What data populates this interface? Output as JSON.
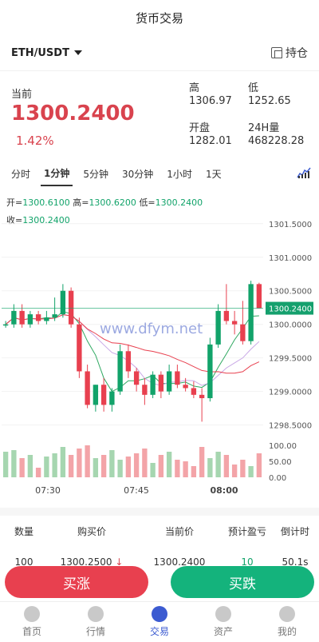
{
  "header": {
    "title": "货币交易"
  },
  "pairbar": {
    "pair": "ETH/USDT",
    "position_label": "持仓"
  },
  "stats": {
    "current_label": "当前",
    "current_price": "1300.2400",
    "change_pct": "1.42%",
    "high_label": "高",
    "high_value": "1306.97",
    "low_label": "低",
    "low_value": "1252.65",
    "open_label": "开盘",
    "open_value": "1282.01",
    "vol_label": "24H量",
    "vol_value": "468228.28"
  },
  "tabs": [
    "分时",
    "1分钟",
    "5分钟",
    "30分钟",
    "1小时",
    "1天"
  ],
  "active_tab": 1,
  "ohlc": {
    "open_label": "开=",
    "open": "1300.6100",
    "high_label": "高=",
    "high": "1300.6200",
    "low_label": "低=",
    "low": "1300.2400",
    "close_label": "收=",
    "close": "1300.2400"
  },
  "watermark": "www.dfym.net",
  "chart_data": {
    "type": "candlestick",
    "y_ticks": [
      "1301.5000",
      "1301.0000",
      "1300.5000",
      "1300.0000",
      "1299.5000",
      "1299.0000",
      "1298.5000"
    ],
    "ylim": [
      1298.4,
      1301.7
    ],
    "last_price": "1300.2400",
    "x_ticks": [
      "07:30",
      "07:45",
      "08:00"
    ],
    "vol_ticks": [
      "100.00",
      "50.00",
      "0.00"
    ],
    "candles": [
      [
        1300.0,
        1300.05,
        1299.95,
        1300.0
      ],
      [
        1300.0,
        1300.3,
        1299.95,
        1300.2
      ],
      [
        1300.2,
        1300.3,
        1299.95,
        1300.0
      ],
      [
        1300.0,
        1300.2,
        1299.95,
        1300.15
      ],
      [
        1300.15,
        1300.2,
        1300.0,
        1300.05
      ],
      [
        1300.05,
        1300.2,
        1300.0,
        1300.1
      ],
      [
        1300.1,
        1300.4,
        1300.05,
        1300.15
      ],
      [
        1300.15,
        1300.6,
        1300.1,
        1300.5
      ],
      [
        1300.5,
        1300.55,
        1299.95,
        1300.0
      ],
      [
        1300.0,
        1300.1,
        1299.2,
        1299.3
      ],
      [
        1299.3,
        1299.4,
        1298.75,
        1298.8
      ],
      [
        1298.8,
        1299.1,
        1298.7,
        1299.1
      ],
      [
        1299.1,
        1299.2,
        1298.7,
        1298.8
      ],
      [
        1298.8,
        1299.05,
        1298.7,
        1299.0
      ],
      [
        1299.0,
        1299.7,
        1298.95,
        1299.6
      ],
      [
        1299.6,
        1299.7,
        1299.2,
        1299.3
      ],
      [
        1299.3,
        1299.35,
        1299.0,
        1299.1
      ],
      [
        1299.1,
        1299.2,
        1298.8,
        1298.95
      ],
      [
        1298.95,
        1299.3,
        1298.9,
        1299.25
      ],
      [
        1299.25,
        1299.3,
        1298.9,
        1299.0
      ],
      [
        1299.0,
        1299.4,
        1298.95,
        1299.3
      ],
      [
        1299.3,
        1299.4,
        1299.05,
        1299.1
      ],
      [
        1299.1,
        1299.2,
        1299.0,
        1299.05
      ],
      [
        1299.05,
        1299.15,
        1298.9,
        1298.95
      ],
      [
        1298.95,
        1299.05,
        1298.55,
        1298.9
      ],
      [
        1298.9,
        1299.8,
        1298.85,
        1299.7
      ],
      [
        1299.7,
        1300.3,
        1299.65,
        1300.2
      ],
      [
        1300.2,
        1300.6,
        1300.0,
        1300.05
      ],
      [
        1300.05,
        1300.2,
        1299.85,
        1300.0
      ],
      [
        1300.0,
        1300.35,
        1299.7,
        1299.75
      ],
      [
        1299.75,
        1300.65,
        1299.7,
        1300.6
      ],
      [
        1300.6,
        1300.62,
        1300.24,
        1300.24
      ]
    ],
    "volumes": [
      80,
      85,
      60,
      70,
      30,
      65,
      75,
      95,
      70,
      90,
      100,
      60,
      70,
      85,
      55,
      65,
      75,
      90,
      45,
      70,
      80,
      55,
      50,
      35,
      95,
      60,
      80,
      70,
      40,
      55,
      35,
      75
    ]
  },
  "table": {
    "headers": [
      "数量",
      "购买价",
      "当前价",
      "预计盈亏",
      "倒计时"
    ],
    "rows": [
      {
        "qty": "100",
        "buy": "1300.2500",
        "current": "1300.2400",
        "pnl": "10",
        "countdown": "50.1s"
      }
    ]
  },
  "buttons": {
    "up": "买涨",
    "down": "买跌"
  },
  "nav": {
    "items": [
      "首页",
      "行情",
      "交易",
      "资产",
      "我的"
    ],
    "active": 2
  },
  "colors": {
    "up": "#e8404f",
    "down": "#14b37c",
    "accent": "#3c5bd1"
  }
}
